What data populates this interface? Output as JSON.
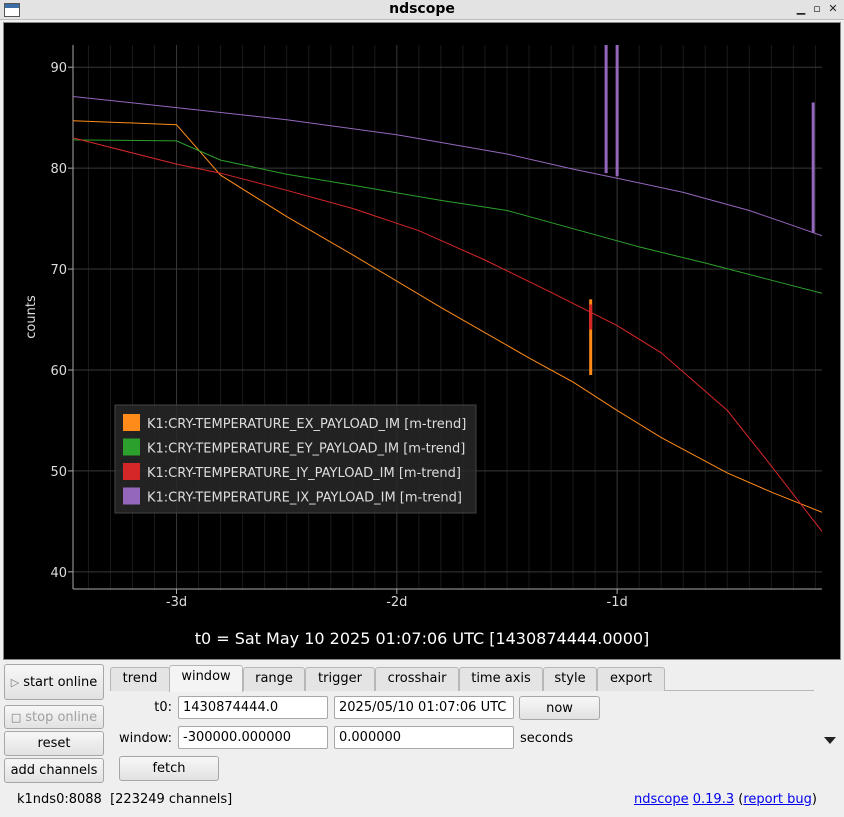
{
  "window": {
    "title": "ndscope"
  },
  "plot": {
    "ylabel": "counts",
    "t0_label": "t0 = Sat May 10 2025 01:07:06 UTC [1430874444.0000]",
    "y_ticks": [
      "90",
      "80",
      "70",
      "60",
      "50",
      "40"
    ],
    "x_ticks": [
      "-3d",
      "-2d",
      "-1d"
    ],
    "legend": [
      {
        "name": "K1:CRY-TEMPERATURE_EX_PAYLOAD_IM [m-trend]",
        "color": "#ff8c1a"
      },
      {
        "name": "K1:CRY-TEMPERATURE_EY_PAYLOAD_IM [m-trend]",
        "color": "#2ca02c"
      },
      {
        "name": "K1:CRY-TEMPERATURE_IY_PAYLOAD_IM [m-trend]",
        "color": "#d62728"
      },
      {
        "name": "K1:CRY-TEMPERATURE_IX_PAYLOAD_IM [m-trend]",
        "color": "#9467bd"
      }
    ]
  },
  "chart_data": {
    "type": "line",
    "xlabel": "",
    "ylabel": "counts",
    "x_unit": "days relative to t0",
    "xlim": [
      -3.47,
      -0.07
    ],
    "ylim": [
      38.3,
      92.2
    ],
    "grid": true,
    "legend_position": "bottom-left",
    "series": [
      {
        "name": "K1:CRY-TEMPERATURE_EX_PAYLOAD_IM [m-trend]",
        "color": "#ff8c1a",
        "x": [
          -3.47,
          -3.0,
          -2.8,
          -2.5,
          -2.2,
          -1.8,
          -1.4,
          -1.2,
          -1.0,
          -0.8,
          -0.5,
          -0.3,
          -0.07
        ],
        "y": [
          84.7,
          84.3,
          79.3,
          75.2,
          71.4,
          66.2,
          61.2,
          58.8,
          56.0,
          53.3,
          49.8,
          47.9,
          45.9
        ],
        "spikes": [
          {
            "x": -1.12,
            "from": 59.5,
            "to": 67.0
          }
        ]
      },
      {
        "name": "K1:CRY-TEMPERATURE_EY_PAYLOAD_IM [m-trend]",
        "color": "#2ca02c",
        "x": [
          -3.47,
          -3.0,
          -2.8,
          -2.5,
          -2.2,
          -1.8,
          -1.5,
          -1.2,
          -0.9,
          -0.6,
          -0.3,
          -0.07
        ],
        "y": [
          82.8,
          82.7,
          80.8,
          79.4,
          78.3,
          76.8,
          75.8,
          74.0,
          72.2,
          70.6,
          68.9,
          67.6
        ]
      },
      {
        "name": "K1:CRY-TEMPERATURE_IY_PAYLOAD_IM [m-trend]",
        "color": "#d62728",
        "x": [
          -3.47,
          -3.0,
          -2.8,
          -2.5,
          -2.2,
          -1.9,
          -1.6,
          -1.3,
          -1.0,
          -0.8,
          -0.5,
          -0.3,
          -0.07
        ],
        "y": [
          83.0,
          80.4,
          79.5,
          77.8,
          76.0,
          73.8,
          70.9,
          67.7,
          64.4,
          61.7,
          56.0,
          50.5,
          44.0
        ],
        "spikes": [
          {
            "x": -1.12,
            "from": 64.0,
            "to": 66.5
          }
        ]
      },
      {
        "name": "K1:CRY-TEMPERATURE_IX_PAYLOAD_IM [m-trend]",
        "color": "#9467bd",
        "x": [
          -3.47,
          -3.0,
          -2.5,
          -2.0,
          -1.5,
          -1.2,
          -1.0,
          -0.7,
          -0.4,
          -0.2,
          -0.07
        ],
        "y": [
          87.1,
          86.0,
          84.8,
          83.3,
          81.4,
          79.9,
          79.0,
          77.6,
          75.8,
          74.3,
          73.3
        ],
        "spikes": [
          {
            "x": -1.05,
            "from": 79.5,
            "to": 92.2
          },
          {
            "x": -1.0,
            "from": 79.2,
            "to": 92.2
          },
          {
            "x": -0.11,
            "from": 73.6,
            "to": 86.5
          }
        ]
      }
    ]
  },
  "buttons": {
    "start_online": "start online",
    "stop_online": "stop online",
    "reset": "reset",
    "add_channels": "add channels"
  },
  "tabs": [
    "trend",
    "window",
    "range",
    "trigger",
    "crosshair",
    "time axis",
    "style",
    "export"
  ],
  "active_tab": "window",
  "form": {
    "t0_label": "t0:",
    "t0_gps": "1430874444.0",
    "t0_utc": "2025/05/10 01:07:06 UTC",
    "now": "now",
    "window_label": "window:",
    "window_start": "-300000.000000",
    "window_end": "0.000000",
    "seconds": "seconds",
    "fetch": "fetch"
  },
  "status": {
    "server": "k1nds0:8088",
    "channels": "[223249 channels]"
  },
  "footer": {
    "app": "ndscope",
    "version": "0.19.3",
    "open_paren": " (",
    "report_bug": "report bug",
    "close_paren": ")"
  }
}
